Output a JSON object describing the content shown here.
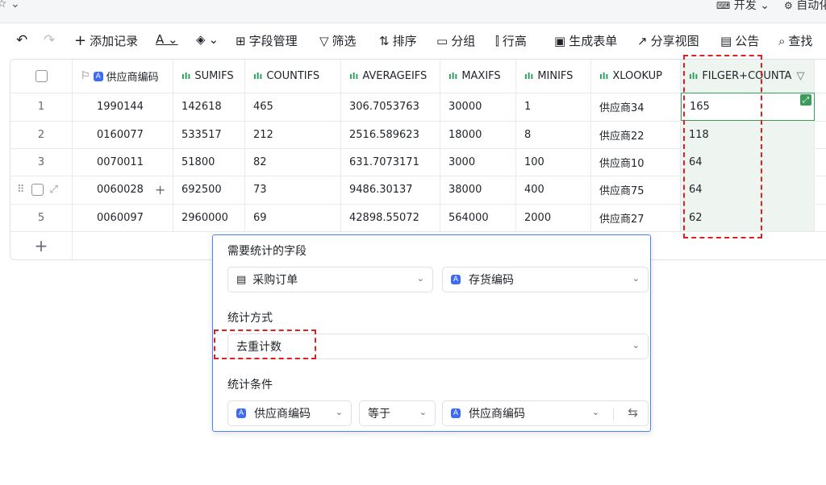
{
  "topbar": {
    "left_icon": "☆ ⌄",
    "right1": "开发 ⌄",
    "right2": "自动化"
  },
  "toolbar": {
    "undo": "↶",
    "redo": "↷",
    "add_record": "添加记录",
    "text_color": "A ⌄",
    "fill_color": "⌄",
    "field_manage": "字段管理",
    "filter": "筛选",
    "sort": "排序",
    "group": "分组",
    "row_height": "行高",
    "gen_form": "生成表单",
    "share_view": "分享视图",
    "notice": "公告",
    "search": "查找"
  },
  "table": {
    "headers": [
      "供应商编码",
      "SUMIFS",
      "COUNTIFS",
      "AVERAGEIFS",
      "MAXIFS",
      "MINIFS",
      "XLOOKUP",
      "FILGER+COUNTA"
    ],
    "rows": [
      {
        "n": "1",
        "c": [
          "1990144",
          "142618",
          "465",
          "306.7053763",
          "30000",
          "1",
          "供应商34",
          "165"
        ]
      },
      {
        "n": "2",
        "c": [
          "0160077",
          "533517",
          "212",
          "2516.589623",
          "18000",
          "8",
          "供应商22",
          "118"
        ]
      },
      {
        "n": "3",
        "c": [
          "0070011",
          "51800",
          "82",
          "631.7073171",
          "3000",
          "100",
          "供应商10",
          "64"
        ]
      },
      {
        "n": "4",
        "c": [
          "0060028",
          "692500",
          "73",
          "9486.30137",
          "38000",
          "400",
          "供应商75",
          "64"
        ]
      },
      {
        "n": "5",
        "c": [
          "0060097",
          "2960000",
          "69",
          "42898.55072",
          "564000",
          "2000",
          "供应商27",
          "62"
        ]
      }
    ],
    "add_row": "+"
  },
  "panel": {
    "field_label": "需要统计的字段",
    "field_table": "采购订单",
    "field_col": "存货编码",
    "method_label": "统计方式",
    "method_value": "去重计数",
    "cond_label": "统计条件",
    "cond_field": "供应商编码",
    "cond_op": "等于",
    "cond_value": "供应商编码"
  }
}
